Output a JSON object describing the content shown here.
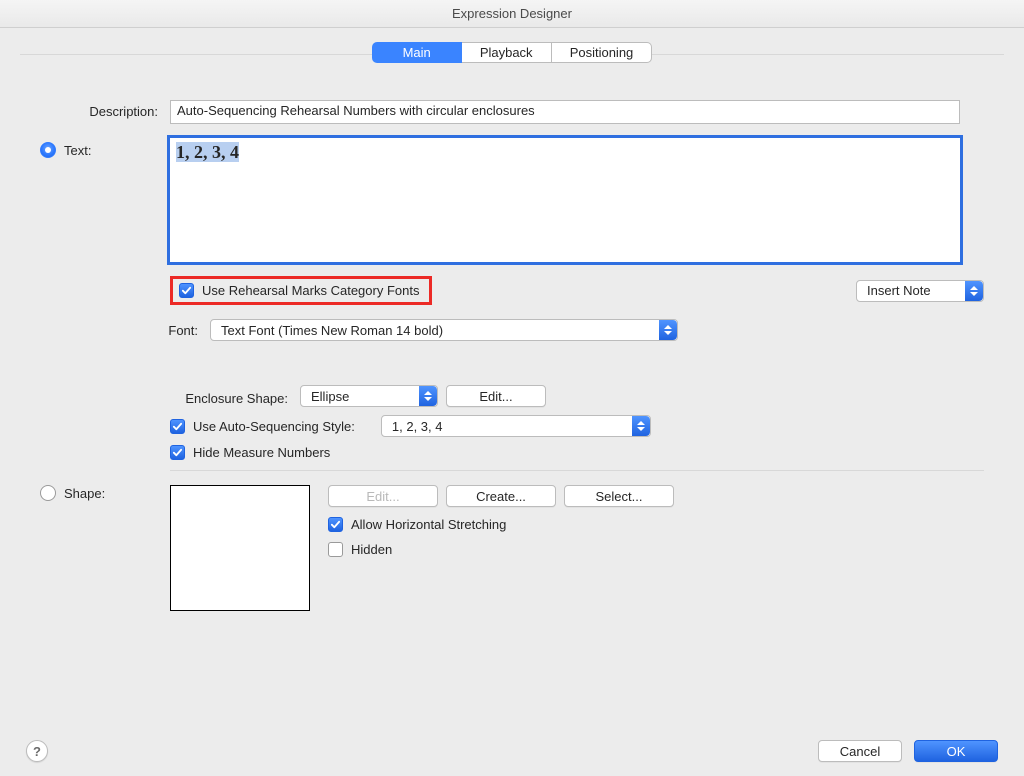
{
  "window": {
    "title": "Expression Designer"
  },
  "tabs": {
    "main": "Main",
    "playback": "Playback",
    "positioning": "Positioning"
  },
  "fields": {
    "description_label": "Description:",
    "description_value": "Auto-Sequencing Rehearsal Numbers with circular enclosures",
    "text_radio_label": "Text:",
    "text_value": "1, 2, 3, 4",
    "use_category_fonts_label": "Use Rehearsal Marks Category Fonts",
    "insert_note_label": "Insert Note",
    "font_label": "Font:",
    "font_value": "Text Font (Times New Roman 14 bold)",
    "enclosure_label": "Enclosure Shape:",
    "enclosure_value": "Ellipse",
    "enclosure_edit": "Edit...",
    "use_autoseq_label": "Use Auto-Sequencing Style:",
    "autoseq_value": "1, 2, 3, 4",
    "hide_measure_label": "Hide Measure Numbers",
    "shape_radio_label": "Shape:",
    "shape_edit": "Edit...",
    "shape_create": "Create...",
    "shape_select": "Select...",
    "allow_hstretch": "Allow Horizontal Stretching",
    "hidden_label": "Hidden"
  },
  "footer": {
    "help": "?",
    "cancel": "Cancel",
    "ok": "OK"
  }
}
